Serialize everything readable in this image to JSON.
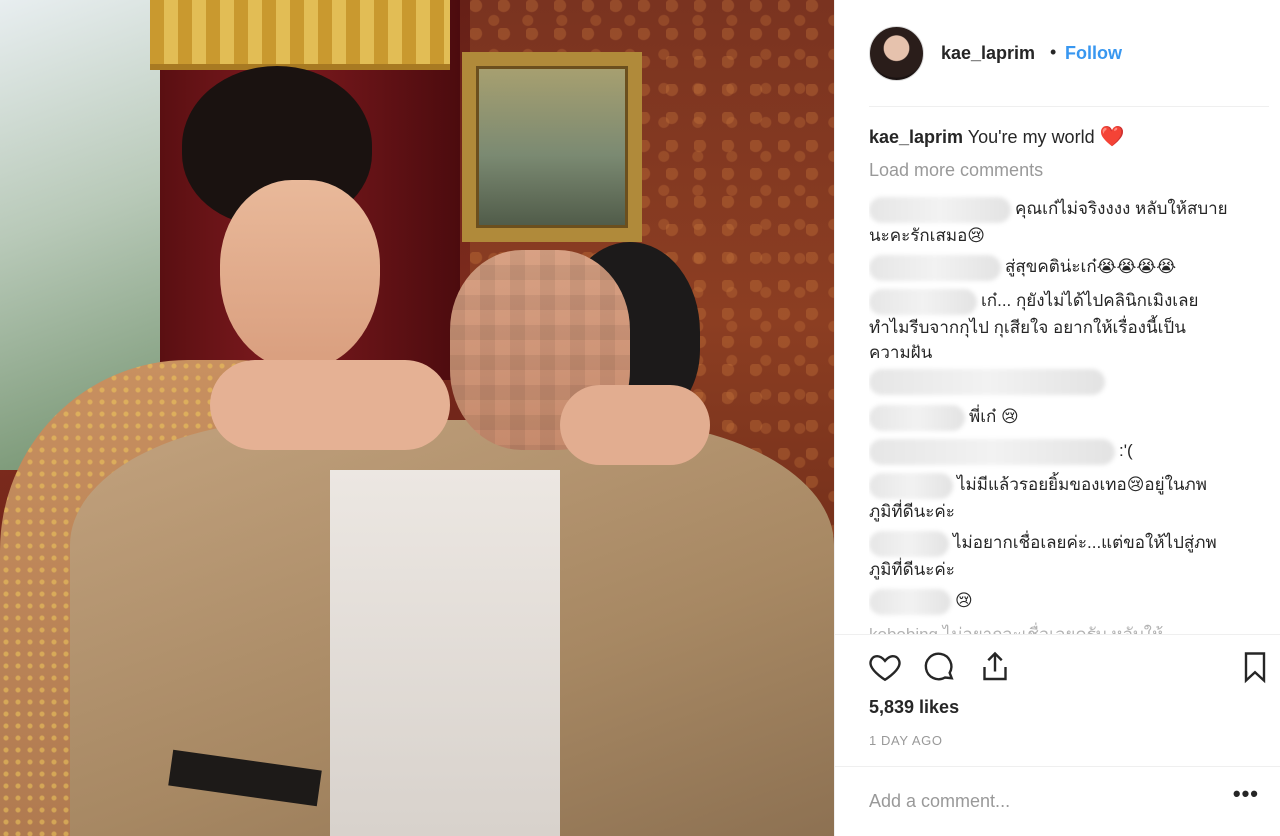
{
  "post": {
    "username": "kae_laprim",
    "separator": "•",
    "follow_label": "Follow",
    "caption_text": "You're my world",
    "caption_emoji": "❤️",
    "load_more_label": "Load more comments",
    "likes": "5,839 likes",
    "time": "1 DAY AGO",
    "comment_placeholder": "Add a comment...",
    "more_label": "•••"
  },
  "comments": [
    {
      "text_1": "คุณเก๋ไม่จริงงงง หลับให้สบาย",
      "text_2": "นะคะรักเสมอ😢"
    },
    {
      "text_1": "สู่สุขคติน่ะเก๋😭😭😭😭"
    },
    {
      "text_1": "เก๋... กุยังไม่ได้ไปคลินิกเมิงเลย",
      "text_2": "ทำไมรีบจากกุไป กุเสียใจ อยากให้เรื่องนี้เป็น",
      "text_3": "ความฝัน"
    },
    {
      "text_1": ""
    },
    {
      "text_1": "พี่เก๋ 😢"
    },
    {
      "text_1": ":'("
    },
    {
      "text_1": "ไม่มีแล้วรอยยิ้มของเทอ😢อยู่ในภพ",
      "text_2": "ภูมิที่ดีนะค่ะ"
    },
    {
      "text_1": "ไม่อยากเชื่อเลยค่ะ...แต่ขอให้ไปสู่ภพ",
      "text_2": "ภูมิที่ดีนะค่ะ"
    },
    {
      "text_1": "😢"
    },
    {
      "text_1": "kobobing ไม่อยากจะเชื่อเลยครับ หลับให้"
    }
  ],
  "icons": {
    "like": "heart-icon",
    "comment": "comment-bubble-icon",
    "share": "share-icon",
    "save": "bookmark-icon"
  },
  "colors": {
    "follow": "#3897f0",
    "text": "#262626",
    "muted": "#999999",
    "heart": "#e0232e"
  }
}
